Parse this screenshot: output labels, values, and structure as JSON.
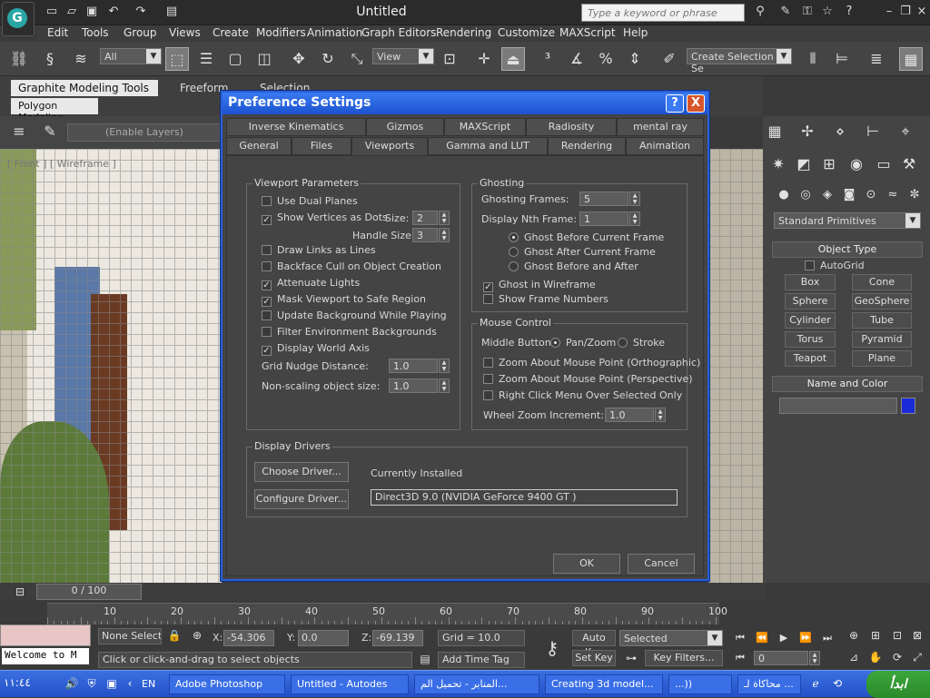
{
  "app": {
    "title": "Untitled",
    "search_placeholder": "Type a keyword or phrase"
  },
  "menu": [
    "Edit",
    "Tools",
    "Group",
    "Views",
    "Create",
    "Modifiers",
    "Animation",
    "Graph Editors",
    "Rendering",
    "Customize",
    "MAXScript",
    "Help"
  ],
  "toolbar": {
    "filter": "All",
    "ref_coord": "View",
    "selection_set": "Create Selection Se"
  },
  "ribbon": {
    "tabs": [
      "Graphite Modeling Tools",
      "Freeform",
      "Selection"
    ],
    "sub_tab": "Polygon Modeling",
    "layers": "(Enable Layers)"
  },
  "viewport": {
    "label": "[ Front ] [ Wireframe ]"
  },
  "dialog": {
    "title": "Preference Settings",
    "help": "?",
    "close": "X",
    "tabs_back": [
      "Inverse Kinematics",
      "Gizmos",
      "MAXScript",
      "Radiosity",
      "mental ray"
    ],
    "tabs_front": [
      "General",
      "Files",
      "Viewports",
      "Gamma and LUT",
      "Rendering",
      "Animation"
    ],
    "viewport_params": {
      "label": "Viewport Parameters",
      "use_dual_planes": "Use Dual Planes",
      "show_vertices": "Show Vertices as Dots",
      "size_label": "Size:",
      "size": "2",
      "handle_label": "Handle Size:",
      "handle": "3",
      "draw_links": "Draw Links as Lines",
      "backface": "Backface Cull on Object Creation",
      "attenuate": "Attenuate Lights",
      "mask": "Mask Viewport to Safe Region",
      "update_bg": "Update Background While Playing",
      "filter_env": "Filter Environment Backgrounds",
      "world_axis": "Display World Axis",
      "grid_nudge_label": "Grid Nudge Distance:",
      "grid_nudge": "1.0",
      "nonscaling_label": "Non-scaling object size:",
      "nonscaling": "1.0"
    },
    "ghosting": {
      "label": "Ghosting",
      "frames_label": "Ghosting Frames:",
      "frames": "5",
      "nth_label": "Display Nth Frame:",
      "nth": "1",
      "before": "Ghost Before Current Frame",
      "after": "Ghost After Current Frame",
      "both": "Ghost Before and After",
      "wireframe": "Ghost in Wireframe",
      "frame_numbers": "Show Frame Numbers"
    },
    "mouse": {
      "label": "Mouse Control",
      "middle_label": "Middle Button:",
      "panzoom": "Pan/Zoom",
      "stroke": "Stroke",
      "zoom_ortho": "Zoom About Mouse Point (Orthographic)",
      "zoom_persp": "Zoom About Mouse Point (Perspective)",
      "right_click": "Right Click Menu Over Selected Only",
      "wheel_label": "Wheel Zoom Increment:",
      "wheel": "1.0"
    },
    "drivers": {
      "label": "Display Drivers",
      "choose": "Choose Driver...",
      "configure": "Configure Driver...",
      "installed_label": "Currently Installed",
      "installed": "Direct3D 9.0 (NVIDIA GeForce 9400 GT )"
    },
    "ok": "OK",
    "cancel": "Cancel"
  },
  "command_panel": {
    "category": "Standard Primitives",
    "object_type": "Object Type",
    "autogrid": "AutoGrid",
    "buttons": [
      "Box",
      "Cone",
      "Sphere",
      "GeoSphere",
      "Cylinder",
      "Tube",
      "Torus",
      "Pyramid",
      "Teapot",
      "Plane"
    ],
    "name_color": "Name and Color",
    "color": "#1a2ad8"
  },
  "timeline": {
    "frame": "0 / 100",
    "ticks": [
      "10",
      "20",
      "30",
      "40",
      "50",
      "60",
      "70",
      "80",
      "90",
      "100"
    ]
  },
  "status": {
    "script": "Welcome to M",
    "selected": "None Selecte",
    "x_label": "X:",
    "x": "-54.306",
    "y_label": "Y:",
    "y": "0.0",
    "z_label": "Z:",
    "z": "-69.139",
    "grid": "Grid = 10.0",
    "prompt": "Click or click-and-drag to select objects",
    "add_time_tag": "Add Time Tag",
    "auto_key": "Auto Key",
    "set_key": "Set Key",
    "key_mode": "Selected",
    "key_filters": "Key Filters...",
    "frame_field": "0"
  },
  "taskbar": {
    "time": "١١:٤٤",
    "lang": "EN",
    "tasks": [
      "Adobe Photoshop",
      "Untitled - Autodes",
      "المنابر - تحميل الم...",
      "Creating 3d model...",
      "...)) ",
      "محاكاة لـ ..."
    ],
    "start": "ابدأ"
  }
}
